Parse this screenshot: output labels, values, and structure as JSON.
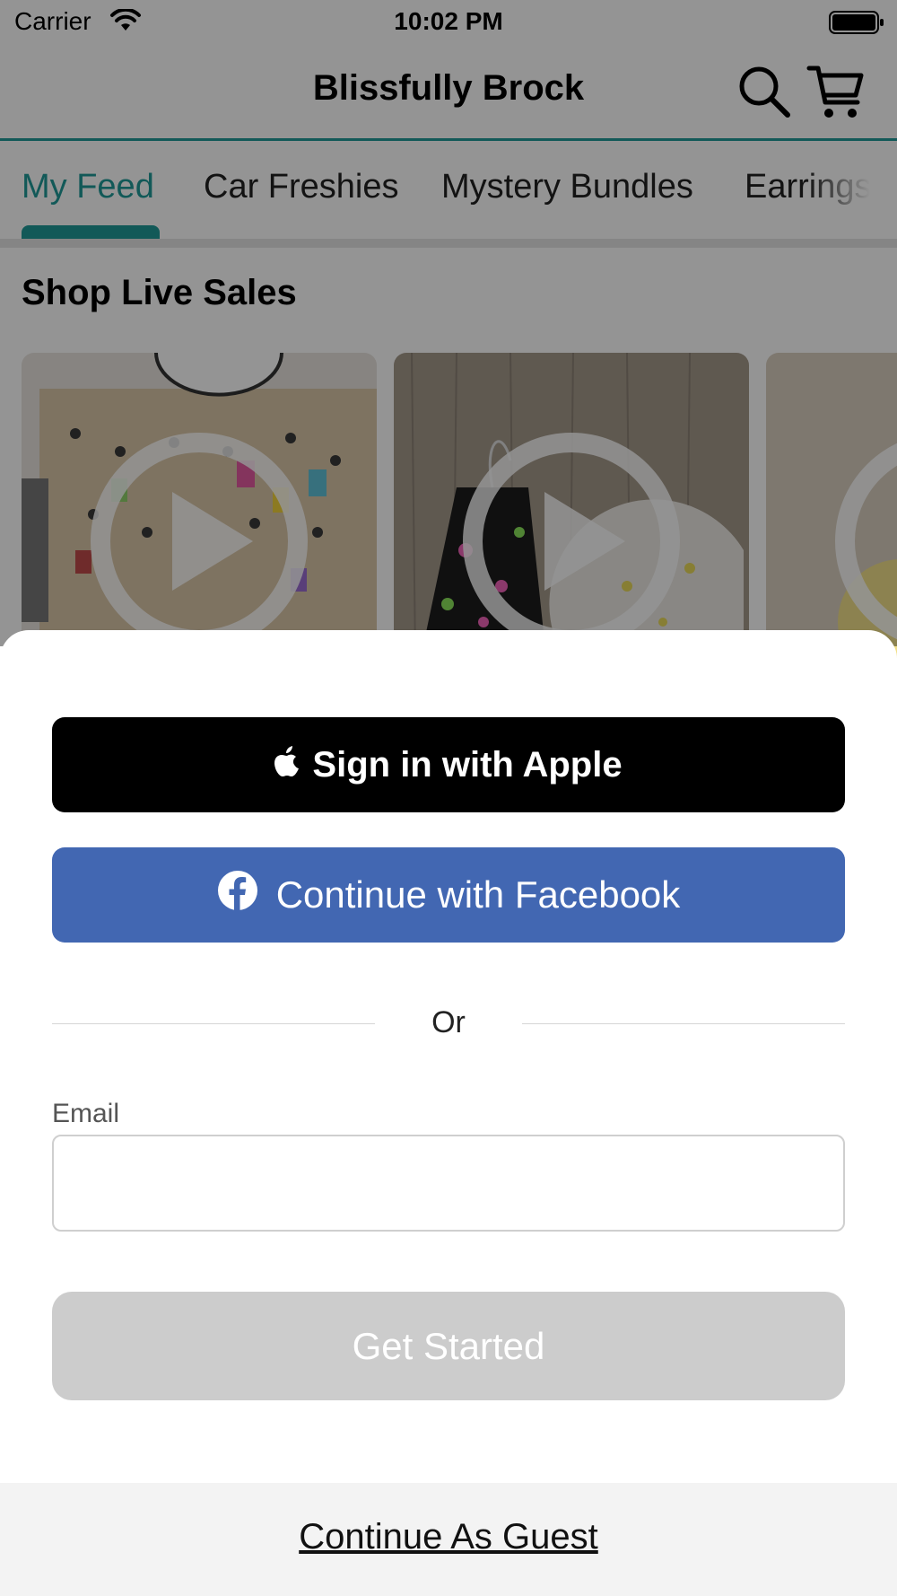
{
  "status_bar": {
    "carrier": "Carrier",
    "time": "10:02 PM"
  },
  "header": {
    "title": "Blissfully Brock",
    "accent_color": "#1f9a98",
    "icons": [
      "search-icon",
      "cart-icon"
    ]
  },
  "tabs": [
    {
      "label": "My Feed",
      "active": true
    },
    {
      "label": "Car Freshies",
      "active": false
    },
    {
      "label": "Mystery Bundles",
      "active": false
    },
    {
      "label": "Earrings",
      "active": false
    }
  ],
  "feed": {
    "section_title": "Shop Live Sales",
    "cards": [
      {
        "thumbnail": "earring-display-wall"
      },
      {
        "thumbnail": "glitter-earrings"
      },
      {
        "thumbnail": "partial-card"
      }
    ]
  },
  "auth_sheet": {
    "apple_button": "Sign in with Apple",
    "facebook_button": "Continue with Facebook",
    "facebook_color": "#4267b2",
    "divider_text": "Or",
    "email_label": "Email",
    "email_value": "",
    "email_placeholder": "",
    "get_started_button": "Get Started",
    "guest_link": "Continue As Guest"
  }
}
